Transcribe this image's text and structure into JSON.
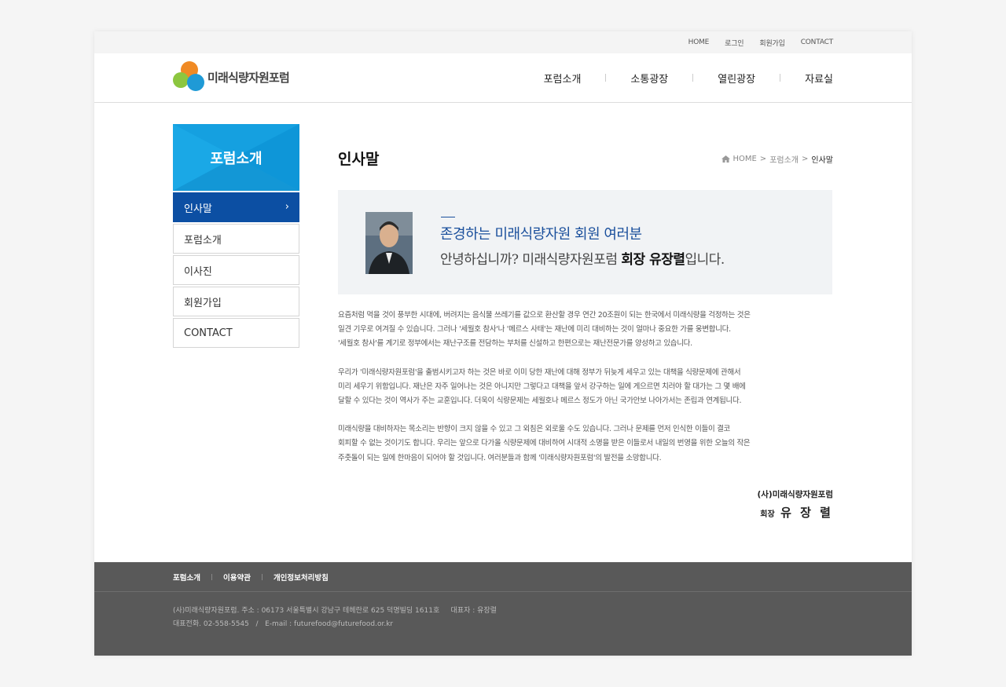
{
  "topbar": {
    "links": [
      "HOME",
      "로그인",
      "회원가입",
      "CONTACT"
    ]
  },
  "logo": {
    "text": "미래식량자원포럼"
  },
  "gnb": {
    "items": [
      "포럼소개",
      "소통광장",
      "열린광장",
      "자료실"
    ]
  },
  "sidebar": {
    "title": "포럼소개",
    "items": [
      {
        "label": "인사말",
        "active": true
      },
      {
        "label": "포럼소개"
      },
      {
        "label": "이사진"
      },
      {
        "label": "회원가입"
      },
      {
        "label": "CONTACT"
      }
    ]
  },
  "page": {
    "title": "인사말",
    "breadcrumb": {
      "home": "HOME",
      "section": "포럼소개",
      "current": "인사말"
    }
  },
  "greeting": {
    "line1": "존경하는 미래식량자원 회원 여러분",
    "line2_pre": "안녕하십니까? 미래식량자원포럼 ",
    "line2_bold": "회장 유장렬",
    "line2_post": "입니다."
  },
  "body": {
    "p1": [
      "요즘처럼 먹을 것이 풍부한 시대에, 버려지는 음식물 쓰레기를 값으로 환산할 경우 연간 20조원이 되는 한국에서 미래식량을 걱정하는 것은",
      "일견 기우로 여겨질 수 있습니다. 그러나 '세월호 참사'나 '메르스 사태'는 재난에 미리 대비하는 것이 얼마나 중요한 가를 웅변합니다.",
      "'세월호 참사'를 계기로 정부에서는 재난구조를 전담하는 부처를 신설하고 한편으로는 재난전문가를 양성하고 있습니다."
    ],
    "p2": [
      "우리가 '미래식량자원포럼'을 출범시키고자 하는 것은 바로 이미 당한 재난에 대해 정부가 뒤늦게 세우고 있는 대책을 식량문제에 관해서",
      "미리 세우기 위함입니다. 재난은 자주 일어나는 것은 아니지만 그렇다고 대책을 앞서 강구하는 일에 게으르면 치러야 할 대가는 그 몇 배에",
      "달할 수 있다는 것이 역사가 주는 교훈입니다. 더욱이 식량문제는 세월호나 메르스 정도가 아닌 국가안보 나아가서는 존립과 연계됩니다."
    ],
    "p3": [
      "미래식량을 대비하자는 목소리는 반향이 크지 않을 수 있고 그 외침은 외로울 수도 있습니다. 그러나 문제를 먼저 인식한 이들이 결코",
      "회피할 수 없는 것이기도 합니다. 우리는 앞으로 다가올 식량문제에 대비하여 시대적 소명을 받은 이들로서 내일의 번영을 위한 오늘의 작은",
      "주춧돌이 되는 일에 한마음이 되어야 할 것입니다. 여러분들과 함께 '미래식량자원포럼'의 발전을 소망합니다."
    ]
  },
  "signature": {
    "org": "(사)미래식량자원포럼",
    "title": "회장",
    "name": "유 장 렬"
  },
  "footer": {
    "links": [
      "포럼소개",
      "이용약관",
      "개인정보처리방침"
    ],
    "info_line1": "(사)미래식량자원포럼. 주소 : 06173 서울특별시 강남구 테헤란로 625 덕명빌딩 1611호     대표자 : 유장렬",
    "info_line2": "대표전화. 02-558-5545   /   E-mail : futurefood@futurefood.or.kr"
  },
  "colors": {
    "accent_blue": "#15a0e0",
    "active_navy": "#0c4fa3",
    "footer_gray": "#595959"
  }
}
